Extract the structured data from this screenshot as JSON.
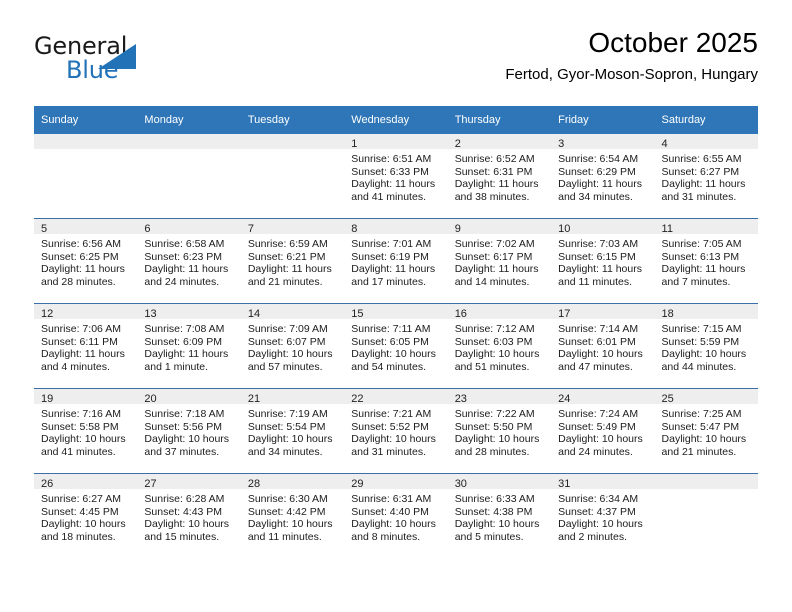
{
  "brand": {
    "line1": "General",
    "line2": "Blue",
    "triangle_color": "#2272b8",
    "text_color": "#1a1a1a"
  },
  "header": {
    "title": "October 2025",
    "subtitle": "Fertod, Gyor-Moson-Sopron, Hungary"
  },
  "theme": {
    "header_blue": "#2e76b8",
    "separator_blue": "#3a6fa8",
    "daystrip_gray": "#eeeeee"
  },
  "calendar": {
    "weekday_headers": [
      "Sunday",
      "Monday",
      "Tuesday",
      "Wednesday",
      "Thursday",
      "Friday",
      "Saturday"
    ],
    "weeks": [
      [
        {
          "day": "",
          "empty": true
        },
        {
          "day": "",
          "empty": true
        },
        {
          "day": "",
          "empty": true
        },
        {
          "day": "1",
          "sunrise": "Sunrise: 6:51 AM",
          "sunset": "Sunset: 6:33 PM",
          "daylight": "Daylight: 11 hours and 41 minutes."
        },
        {
          "day": "2",
          "sunrise": "Sunrise: 6:52 AM",
          "sunset": "Sunset: 6:31 PM",
          "daylight": "Daylight: 11 hours and 38 minutes."
        },
        {
          "day": "3",
          "sunrise": "Sunrise: 6:54 AM",
          "sunset": "Sunset: 6:29 PM",
          "daylight": "Daylight: 11 hours and 34 minutes."
        },
        {
          "day": "4",
          "sunrise": "Sunrise: 6:55 AM",
          "sunset": "Sunset: 6:27 PM",
          "daylight": "Daylight: 11 hours and 31 minutes."
        }
      ],
      [
        {
          "day": "5",
          "sunrise": "Sunrise: 6:56 AM",
          "sunset": "Sunset: 6:25 PM",
          "daylight": "Daylight: 11 hours and 28 minutes."
        },
        {
          "day": "6",
          "sunrise": "Sunrise: 6:58 AM",
          "sunset": "Sunset: 6:23 PM",
          "daylight": "Daylight: 11 hours and 24 minutes."
        },
        {
          "day": "7",
          "sunrise": "Sunrise: 6:59 AM",
          "sunset": "Sunset: 6:21 PM",
          "daylight": "Daylight: 11 hours and 21 minutes."
        },
        {
          "day": "8",
          "sunrise": "Sunrise: 7:01 AM",
          "sunset": "Sunset: 6:19 PM",
          "daylight": "Daylight: 11 hours and 17 minutes."
        },
        {
          "day": "9",
          "sunrise": "Sunrise: 7:02 AM",
          "sunset": "Sunset: 6:17 PM",
          "daylight": "Daylight: 11 hours and 14 minutes."
        },
        {
          "day": "10",
          "sunrise": "Sunrise: 7:03 AM",
          "sunset": "Sunset: 6:15 PM",
          "daylight": "Daylight: 11 hours and 11 minutes."
        },
        {
          "day": "11",
          "sunrise": "Sunrise: 7:05 AM",
          "sunset": "Sunset: 6:13 PM",
          "daylight": "Daylight: 11 hours and 7 minutes."
        }
      ],
      [
        {
          "day": "12",
          "sunrise": "Sunrise: 7:06 AM",
          "sunset": "Sunset: 6:11 PM",
          "daylight": "Daylight: 11 hours and 4 minutes."
        },
        {
          "day": "13",
          "sunrise": "Sunrise: 7:08 AM",
          "sunset": "Sunset: 6:09 PM",
          "daylight": "Daylight: 11 hours and 1 minute."
        },
        {
          "day": "14",
          "sunrise": "Sunrise: 7:09 AM",
          "sunset": "Sunset: 6:07 PM",
          "daylight": "Daylight: 10 hours and 57 minutes."
        },
        {
          "day": "15",
          "sunrise": "Sunrise: 7:11 AM",
          "sunset": "Sunset: 6:05 PM",
          "daylight": "Daylight: 10 hours and 54 minutes."
        },
        {
          "day": "16",
          "sunrise": "Sunrise: 7:12 AM",
          "sunset": "Sunset: 6:03 PM",
          "daylight": "Daylight: 10 hours and 51 minutes."
        },
        {
          "day": "17",
          "sunrise": "Sunrise: 7:14 AM",
          "sunset": "Sunset: 6:01 PM",
          "daylight": "Daylight: 10 hours and 47 minutes."
        },
        {
          "day": "18",
          "sunrise": "Sunrise: 7:15 AM",
          "sunset": "Sunset: 5:59 PM",
          "daylight": "Daylight: 10 hours and 44 minutes."
        }
      ],
      [
        {
          "day": "19",
          "sunrise": "Sunrise: 7:16 AM",
          "sunset": "Sunset: 5:58 PM",
          "daylight": "Daylight: 10 hours and 41 minutes."
        },
        {
          "day": "20",
          "sunrise": "Sunrise: 7:18 AM",
          "sunset": "Sunset: 5:56 PM",
          "daylight": "Daylight: 10 hours and 37 minutes."
        },
        {
          "day": "21",
          "sunrise": "Sunrise: 7:19 AM",
          "sunset": "Sunset: 5:54 PM",
          "daylight": "Daylight: 10 hours and 34 minutes."
        },
        {
          "day": "22",
          "sunrise": "Sunrise: 7:21 AM",
          "sunset": "Sunset: 5:52 PM",
          "daylight": "Daylight: 10 hours and 31 minutes."
        },
        {
          "day": "23",
          "sunrise": "Sunrise: 7:22 AM",
          "sunset": "Sunset: 5:50 PM",
          "daylight": "Daylight: 10 hours and 28 minutes."
        },
        {
          "day": "24",
          "sunrise": "Sunrise: 7:24 AM",
          "sunset": "Sunset: 5:49 PM",
          "daylight": "Daylight: 10 hours and 24 minutes."
        },
        {
          "day": "25",
          "sunrise": "Sunrise: 7:25 AM",
          "sunset": "Sunset: 5:47 PM",
          "daylight": "Daylight: 10 hours and 21 minutes."
        }
      ],
      [
        {
          "day": "26",
          "sunrise": "Sunrise: 6:27 AM",
          "sunset": "Sunset: 4:45 PM",
          "daylight": "Daylight: 10 hours and 18 minutes."
        },
        {
          "day": "27",
          "sunrise": "Sunrise: 6:28 AM",
          "sunset": "Sunset: 4:43 PM",
          "daylight": "Daylight: 10 hours and 15 minutes."
        },
        {
          "day": "28",
          "sunrise": "Sunrise: 6:30 AM",
          "sunset": "Sunset: 4:42 PM",
          "daylight": "Daylight: 10 hours and 11 minutes."
        },
        {
          "day": "29",
          "sunrise": "Sunrise: 6:31 AM",
          "sunset": "Sunset: 4:40 PM",
          "daylight": "Daylight: 10 hours and 8 minutes."
        },
        {
          "day": "30",
          "sunrise": "Sunrise: 6:33 AM",
          "sunset": "Sunset: 4:38 PM",
          "daylight": "Daylight: 10 hours and 5 minutes."
        },
        {
          "day": "31",
          "sunrise": "Sunrise: 6:34 AM",
          "sunset": "Sunset: 4:37 PM",
          "daylight": "Daylight: 10 hours and 2 minutes."
        },
        {
          "day": "",
          "empty": true
        }
      ]
    ]
  }
}
